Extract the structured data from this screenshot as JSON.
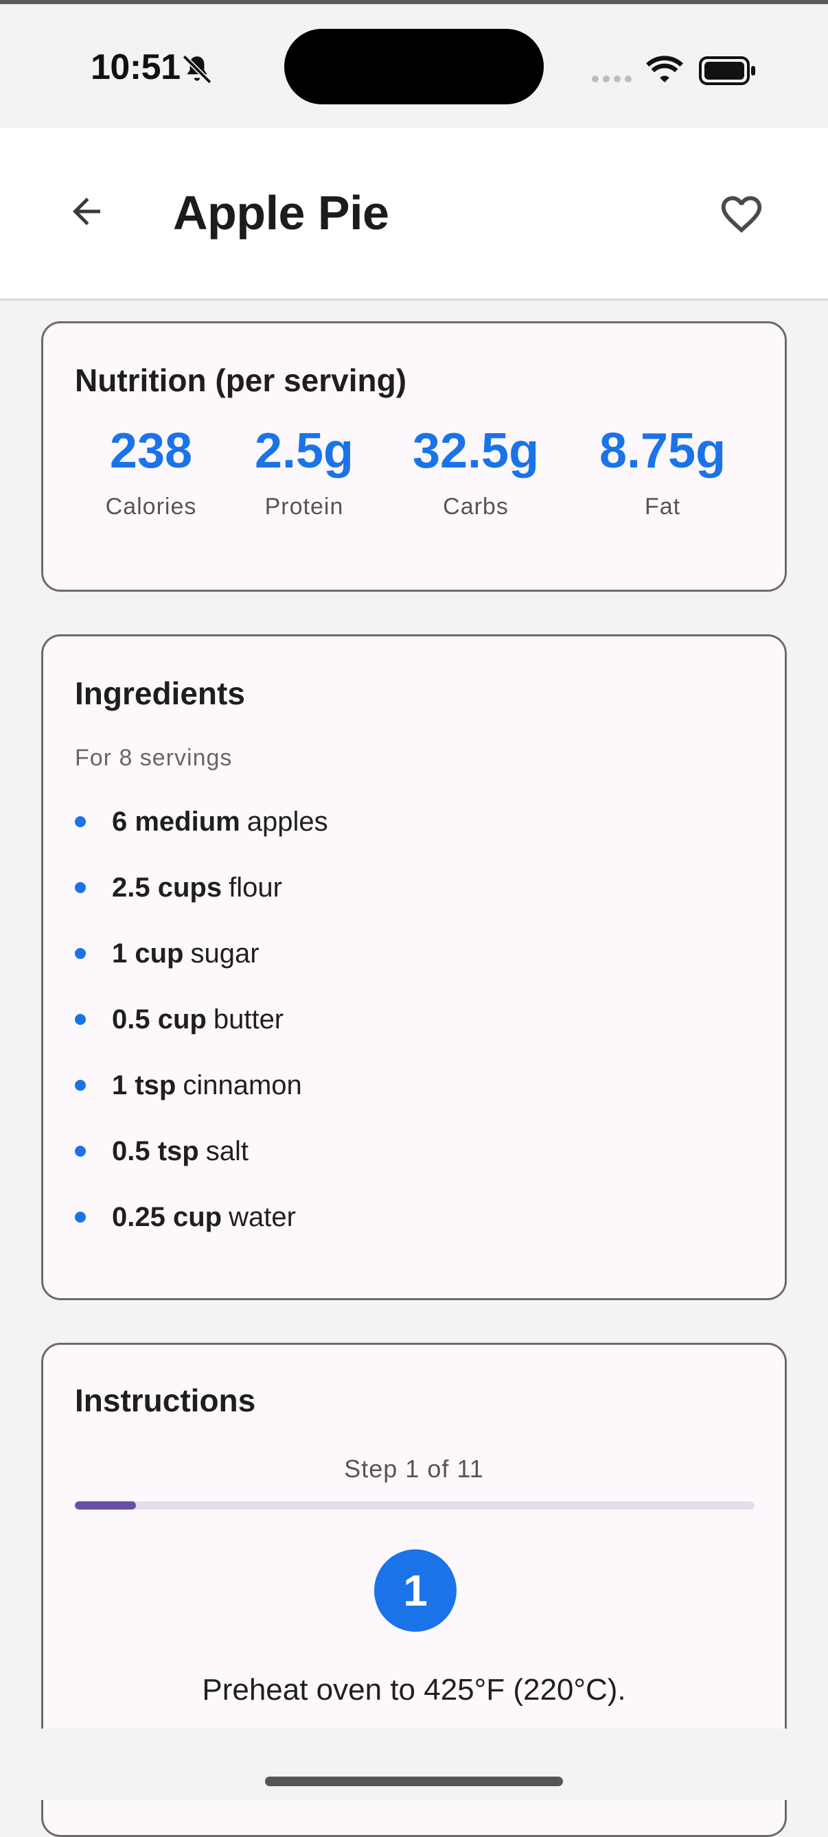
{
  "status_bar": {
    "time": "10:51",
    "icons": [
      "bell-off-icon",
      "signal-icon",
      "wifi-icon",
      "battery-icon"
    ]
  },
  "app_bar": {
    "title": "Apple Pie",
    "back_icon": "arrow-left-icon",
    "favorite_icon": "heart-outline-icon"
  },
  "nutrition": {
    "title": "Nutrition (per serving)",
    "items": [
      {
        "value": "238",
        "label": "Calories"
      },
      {
        "value": "2.5g",
        "label": "Protein"
      },
      {
        "value": "32.5g",
        "label": "Carbs"
      },
      {
        "value": "8.75g",
        "label": "Fat"
      }
    ]
  },
  "ingredients": {
    "title": "Ingredients",
    "servings": "For 8 servings",
    "items": [
      {
        "qty": "6 medium",
        "name": "apples"
      },
      {
        "qty": "2.5 cups",
        "name": "flour"
      },
      {
        "qty": "1 cup",
        "name": "sugar"
      },
      {
        "qty": "0.5 cup",
        "name": "butter"
      },
      {
        "qty": "1 tsp",
        "name": "cinnamon"
      },
      {
        "qty": "0.5 tsp",
        "name": "salt"
      },
      {
        "qty": "0.25 cup",
        "name": "water"
      }
    ]
  },
  "instructions": {
    "title": "Instructions",
    "step_label": "Step 1 of 11",
    "progress": 0.09,
    "current_step_number": "1",
    "current_step_text": "Preheat oven to 425°F (220°C)."
  },
  "colors": {
    "accent": "#1a73e8",
    "progress": "#6a4fa8"
  }
}
